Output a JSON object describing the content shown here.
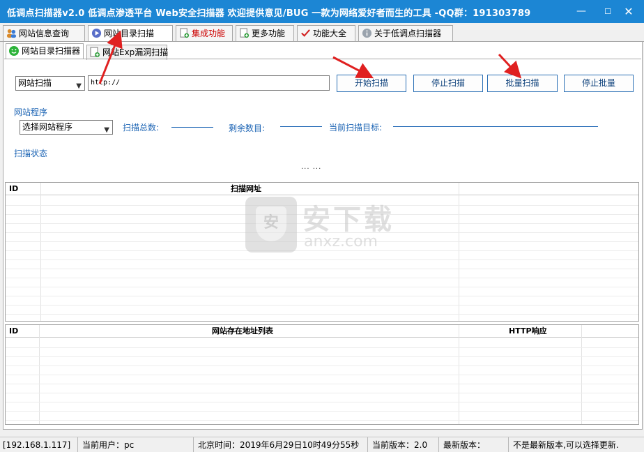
{
  "window": {
    "title": "低调点扫描器v2.0 低调点渗透平台 Web安全扫描器 欢迎提供意见/BUG  一款为网络爱好者而生的工具  -QQ群：191303789",
    "minimize_glyph": "—",
    "maximize_glyph": "☐",
    "close_glyph": "✕"
  },
  "tabs": [
    {
      "label": "网站信息查询",
      "icon": "users-icon"
    },
    {
      "label": "网站目录扫描",
      "icon": "play-circle-icon"
    },
    {
      "label": "集成功能",
      "icon": "page-add-icon"
    },
    {
      "label": "更多功能",
      "icon": "page-add-icon"
    },
    {
      "label": "功能大全",
      "icon": "checkmark-icon"
    },
    {
      "label": "关于低调点扫描器",
      "icon": "info-icon"
    }
  ],
  "subtabs": [
    {
      "label": "网站目录扫描器",
      "icon": "green-smile-icon"
    },
    {
      "label": "网站Exp漏洞扫描",
      "icon": "page-add-icon"
    }
  ],
  "scan": {
    "mode_value": "网站扫描",
    "url_value": "http://",
    "start_label": "开始扫描",
    "stop_label": "停止扫描",
    "batch_label": "批量扫描",
    "stop_batch_label": "停止批量"
  },
  "program": {
    "section_label": "网站程序",
    "select_value": "选择网站程序",
    "total_label": "扫描总数:",
    "remaining_label": "剩余数目:",
    "target_label": "当前扫描目标:"
  },
  "status": {
    "section_label": "扫描状态",
    "progress_text": "... ..."
  },
  "grid_scan": {
    "columns": [
      "ID",
      "扫描网址",
      ""
    ]
  },
  "grid_result": {
    "columns": [
      "ID",
      "网站存在地址列表",
      "HTTP响应"
    ]
  },
  "watermark": {
    "shield_char": "安",
    "title": "安下载",
    "subtitle": "anxz.com"
  },
  "statusbar": {
    "ip": "[192.168.1.117]",
    "user": "当前用户：pc",
    "time": "北京时间：2019年6月29日10时49分55秒",
    "version": "当前版本：2.0",
    "latest_version": "最新版本：",
    "update_note": "不是最新版本,可以选择更新."
  },
  "colors": {
    "titlebar": "#1c86d4",
    "accent_blue": "#1c64b4",
    "arrow_red": "#e02020",
    "highlight_tab_red": "#cc0000"
  }
}
